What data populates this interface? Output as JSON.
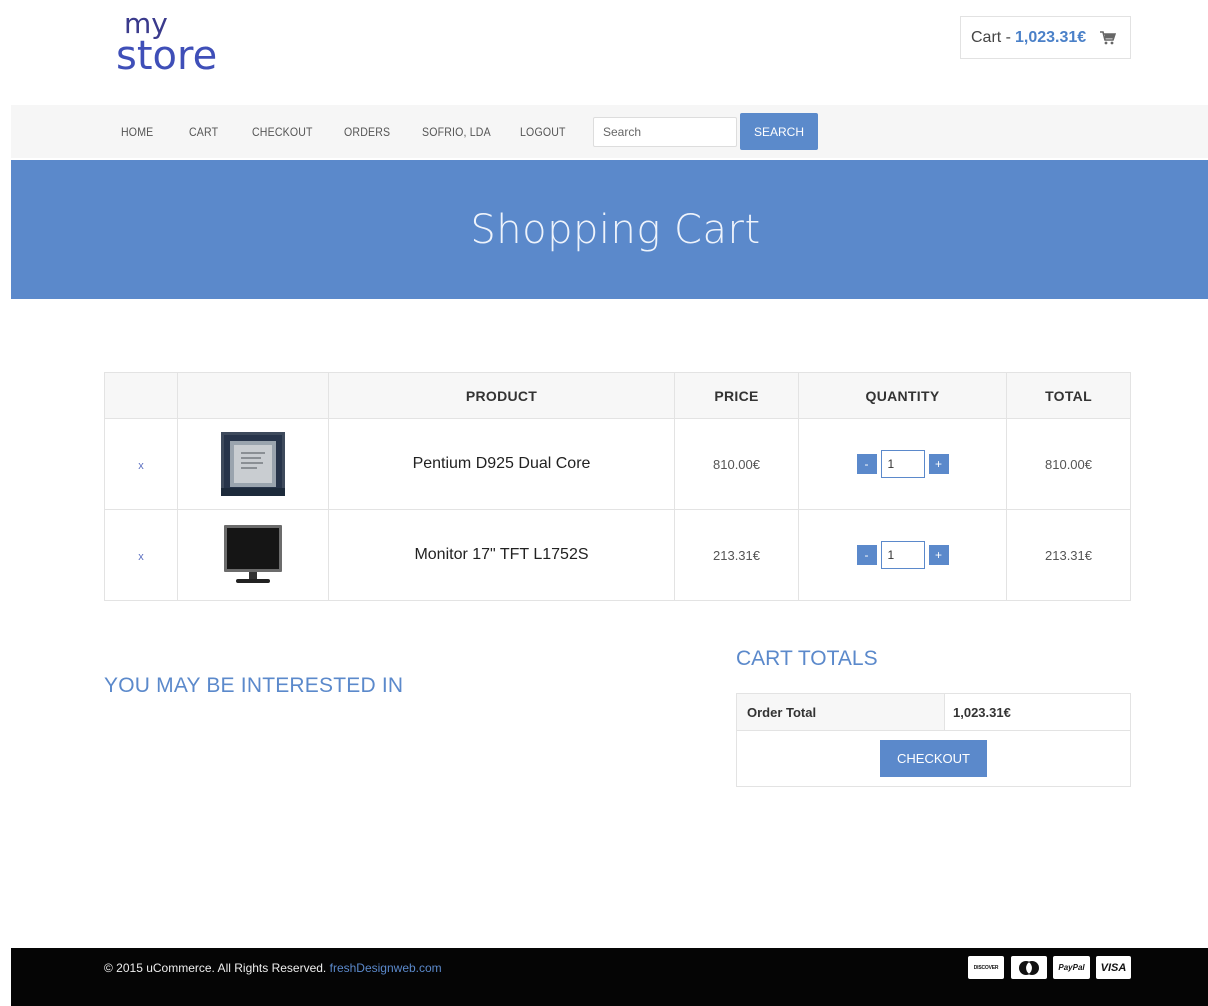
{
  "header": {
    "logo_line1": "my",
    "logo_line2": "store",
    "cart_label": "Cart - ",
    "cart_amount": "1,023.31€"
  },
  "nav": {
    "items": [
      "HOME",
      "CART",
      "CHECKOUT",
      "ORDERS",
      "SOFRIO, LDA",
      "LOGOUT"
    ],
    "search_placeholder": "Search",
    "search_button": "SEARCH"
  },
  "banner": {
    "title": "Shopping Cart"
  },
  "cart": {
    "columns": [
      "",
      "",
      "PRODUCT",
      "PRICE",
      "QUANTITY",
      "TOTAL"
    ],
    "remove_symbol": "x",
    "minus": "-",
    "plus": "+",
    "rows": [
      {
        "product": "Pentium D925 Dual Core",
        "price": "810.00€",
        "quantity": "1",
        "total": "810.00€"
      },
      {
        "product": "Monitor 17\" TFT L1752S",
        "price": "213.31€",
        "quantity": "1",
        "total": "213.31€"
      }
    ]
  },
  "interest": {
    "title": "YOU MAY BE INTERESTED IN"
  },
  "totals": {
    "title": "CART TOTALS",
    "order_total_label": "Order Total",
    "order_total_value": "1,023.31€",
    "checkout_button": "CHECKOUT"
  },
  "footer": {
    "copyright": "© 2015 uCommerce. All Rights Reserved.",
    "link": "freshDesignweb.com",
    "payment_icons": [
      "discover-icon",
      "mastercard-icon",
      "paypal-icon",
      "visa-icon"
    ],
    "payment_labels": {
      "discover": "DISCOVER",
      "paypal": "PayPal",
      "visa": "VISA"
    }
  },
  "colors": {
    "accent": "#5b89cb",
    "logo": "#3f4fb8",
    "footer_bg": "#050505",
    "nav_bg": "#f6f6f6"
  }
}
